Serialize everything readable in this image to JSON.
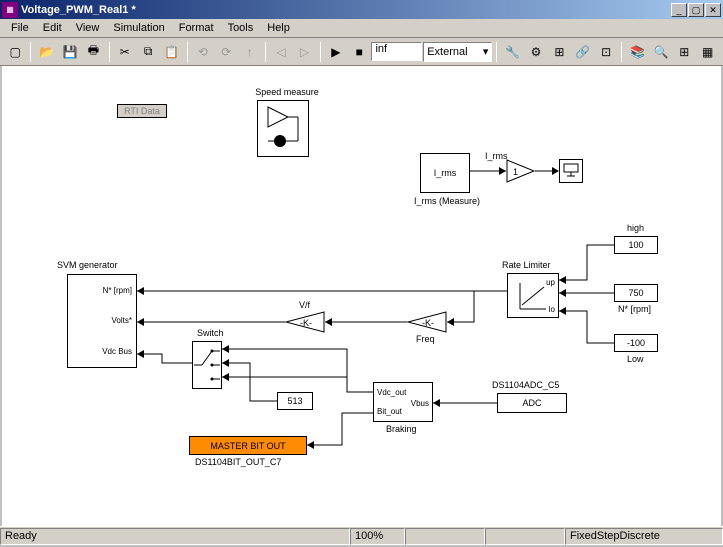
{
  "window": {
    "title": "Voltage_PWM_Real1 *",
    "min": "_",
    "max": "▢",
    "close": "✕"
  },
  "menu": {
    "file": "File",
    "edit": "Edit",
    "view": "View",
    "simulation": "Simulation",
    "format": "Format",
    "tools": "Tools",
    "help": "Help"
  },
  "toolbar": {
    "stoptime": "inf",
    "mode": "External"
  },
  "blocks": {
    "rti_data": "RTI Data",
    "speed_measure": "Speed measure",
    "irms_block": "I_rms",
    "irms_signal": "I_rms",
    "irms_measure_lbl": "I_rms (Measure)",
    "gain1": "1",
    "svm_generator": "SVM generator",
    "svm_p1": "N* [rpm]",
    "svm_p2": "Volts*",
    "svm_p3": "Vdc Bus",
    "vf_lbl": "V/f",
    "vf_gain": "-K-",
    "freq_gain": "-K-",
    "freq_lbl": "Freq",
    "switch_lbl": "Switch",
    "const_513": "513",
    "rate_limiter": "Rate Limiter",
    "rate_up": "up",
    "rate_lo": "lo",
    "high_lbl": "high",
    "high_val": "100",
    "nstar_lbl": "N* [rpm]",
    "nstar_val": "750",
    "low_lbl": "Low",
    "low_val": "-100",
    "braking_lbl": "Braking",
    "braking_vdc": "Vdc_out",
    "braking_bit": "Bit_out",
    "braking_vbus": "Vbus",
    "adc_lbl": "DS1104ADC_C5",
    "adc": "ADC",
    "master_bit": "MASTER BIT OUT",
    "bitout_lbl": "DS1104BIT_OUT_C7"
  },
  "status": {
    "ready": "Ready",
    "zoom": "100%",
    "solver": "FixedStepDiscrete"
  }
}
